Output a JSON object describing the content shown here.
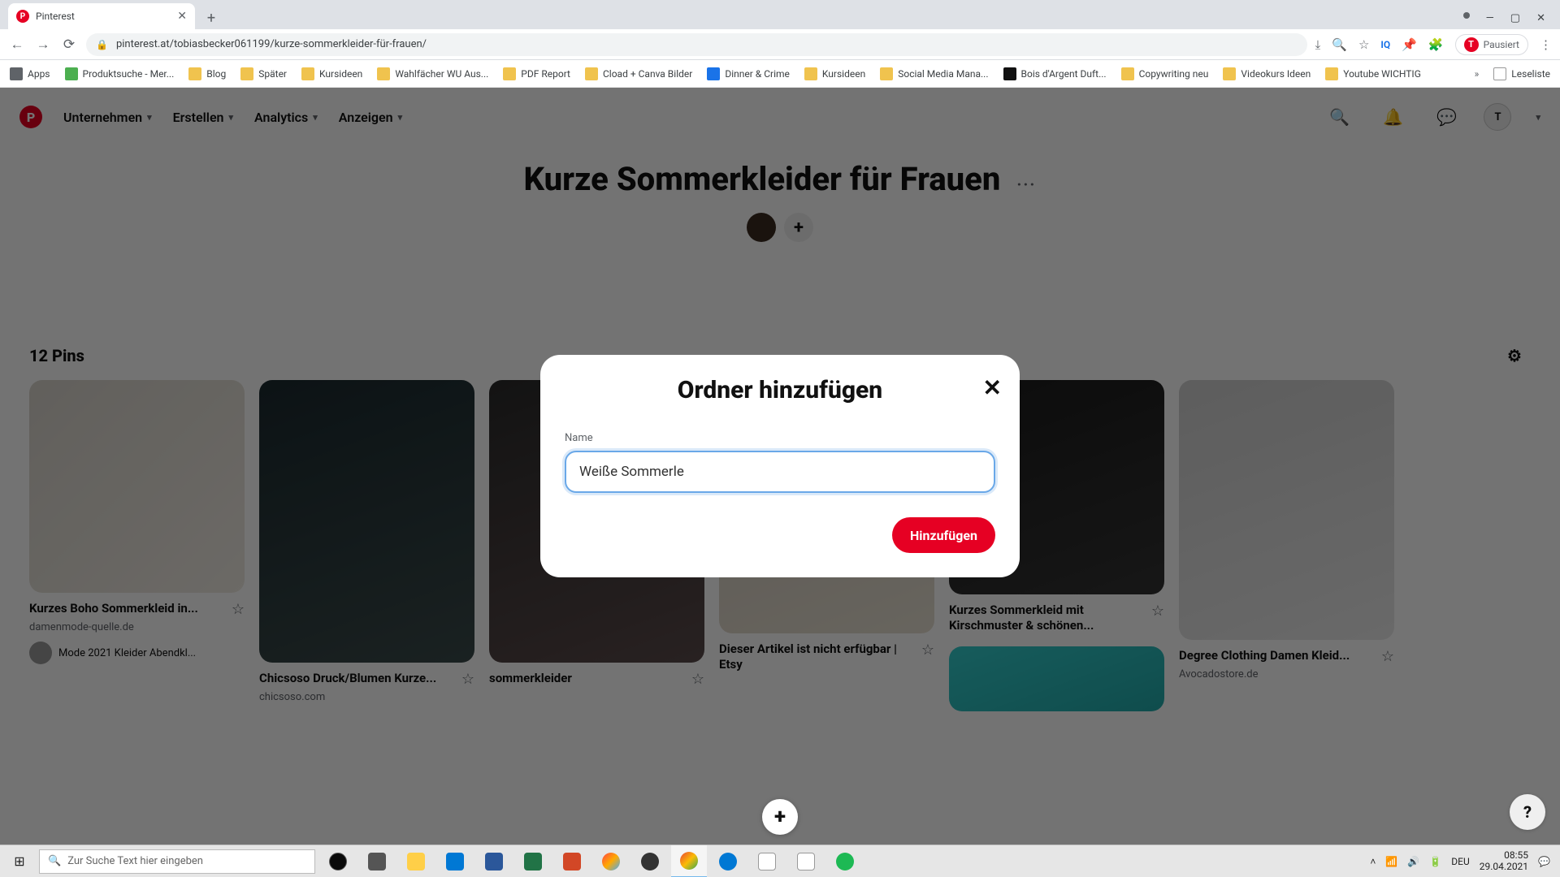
{
  "browser": {
    "tab_title": "Pinterest",
    "url": "pinterest.at/tobiasbecker061199/kurze-sommerkleider-für-frauen/",
    "profile_label": "Pausiert",
    "profile_initial": "T",
    "window": {
      "min": "—",
      "max": "▢",
      "close": "✕"
    }
  },
  "bookmarks": [
    "Apps",
    "Produktsuche - Mer...",
    "Blog",
    "Später",
    "Kursideen",
    "Wahlfächer WU Aus...",
    "PDF Report",
    "Cload + Canva Bilder",
    "Dinner & Crime",
    "Kursideen",
    "Social Media Mana...",
    "Bois d'Argent Duft...",
    "Copywriting neu",
    "Videokurs Ideen",
    "Youtube WICHTIG",
    "Leseliste"
  ],
  "pinterest": {
    "nav": [
      "Unternehmen",
      "Erstellen",
      "Analytics",
      "Anzeigen"
    ],
    "board_title": "Kurze Sommerkleider für Frauen",
    "pins_count": "12 Pins",
    "pins": [
      {
        "title": "Kurzes Boho Sommerkleid in...",
        "source": "damenmode-quelle.de",
        "meta": "Mode 2021 Kleider Abendkl..."
      },
      {
        "title": "Chicsoso Druck/Blumen Kurze...",
        "source": "chicsoso.com"
      },
      {
        "title": "sommerkleider",
        "source": ""
      },
      {
        "title": "Dieser Artikel ist nicht erfügbar | Etsy",
        "source": ""
      },
      {
        "title": "Kurzes Sommerkleid mit Kirschmuster & schönen...",
        "source": ""
      },
      {
        "title": "Degree Clothing Damen Kleid...",
        "source": "Avocadostore.de"
      }
    ]
  },
  "modal": {
    "title": "Ordner hinzufügen",
    "label": "Name",
    "value": "Weiße Sommerle",
    "submit": "Hinzufügen"
  },
  "taskbar": {
    "search_placeholder": "Zur Suche Text hier eingeben",
    "lang": "DEU",
    "time": "08:55",
    "date": "29.04.2021"
  }
}
